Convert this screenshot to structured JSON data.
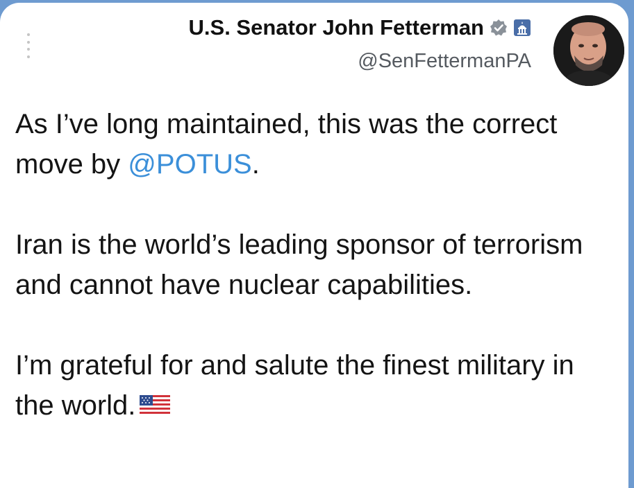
{
  "tweet": {
    "author_name": "U.S. Senator John Fetterman",
    "handle": "@SenFettermanPA",
    "paragraphs": [
      {
        "before": "As I’ve long maintained, this was the correct move by ",
        "mention": "@POTUS",
        "after": "."
      },
      {
        "text": "Iran is the world’s leading sponsor of terrorism and cannot have nuclear capabilities."
      },
      {
        "text": "I’m grateful for and salute the finest military in the world."
      }
    ],
    "emoji": "us-flag-icon"
  },
  "colors": {
    "background_band": "#6e9bd0",
    "card": "#ffffff",
    "text": "#141414",
    "handle": "#555a60",
    "mention": "#3b8fd9",
    "verified_badge": "#8a9199",
    "gov_badge": "#4a6ea8"
  },
  "icons": [
    "more-icon",
    "verified-icon",
    "government-icon",
    "avatar",
    "us-flag-icon"
  ]
}
